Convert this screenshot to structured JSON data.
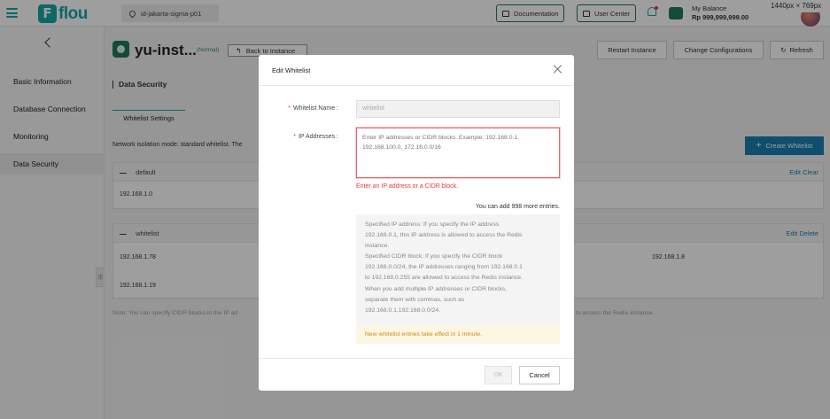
{
  "topbar": {
    "logo_text": "flou",
    "logo_mark": "F",
    "region": "id-jakarta-sigma-p01",
    "documentation": "Documentation",
    "user_center": "User Center",
    "balance_label": "My Balance",
    "balance_amount": "Rp 999,999,999.00",
    "dimension_tag": "1440px × 769px"
  },
  "sidebar": {
    "items": [
      {
        "label": "Basic Information"
      },
      {
        "label": "Database Connection"
      },
      {
        "label": "Monitoring"
      },
      {
        "label": "Data Security"
      }
    ],
    "collapse_glyph": "|||"
  },
  "header": {
    "instance_name": "yu-inst...",
    "status": "(Normal)",
    "back_label": "Back to Instance",
    "restart": "Restart Instance",
    "change_config": "Change Configurations",
    "refresh": "Refresh"
  },
  "main": {
    "section_title": "Data Security",
    "sub_tab": "Whitelist Settings",
    "mode_text": "Network isolation mode: standard whitelist. The",
    "create_button": "Create Whitelist",
    "groups": [
      {
        "name": "default",
        "actions": "Edit  Clear",
        "ips": [
          "192.168.1.0"
        ]
      },
      {
        "name": "whitelist",
        "actions": "Edit  Delete",
        "ips": [
          "192.168.1.78",
          "192.168.1.8",
          "192.168.1.19"
        ]
      }
    ],
    "note_left": "Note: You can specify CIDR blocks in the IP ad",
    "note_right": "to access the Redis instance."
  },
  "modal": {
    "title": "Edit Whitelist",
    "name_label": "Whitelist Name :",
    "name_value": "whitelist",
    "ip_label": "IP Addresses :",
    "ip_placeholder": "Enter IP addresses or CIDR blocks. Example: 192.168.0.1, 192.168.100.0, 172.16.0.0/16",
    "error": "Enter an IP address or a CIDR block.",
    "remaining": "You can add 998 more entries.",
    "info_lines": [
      "Specified IP address: If you specify the IP address",
      "192.168.0.1, this IP address is allowed to access the Redis",
      "instance.",
      "Specified CIDR block: If you specify the CIDR block",
      "192.168.0.0/24, the IP addresses ranging from 192.168.0.1",
      "to 192.168.0.255 are allowed to access the Redis instance.",
      "When you add multiple IP addresses or CIDR blocks,",
      "separate them with commas, such as",
      "192.168.0.1,192.168.0.0/24."
    ],
    "tip": "New whitelist entries take effect in 1 minute.",
    "ok": "OK",
    "cancel": "Cancel"
  },
  "colors": {
    "brand": "#18a6a6",
    "primary_button": "#1a7fb3",
    "error": "#e53935",
    "tip_text": "#c98a12"
  }
}
